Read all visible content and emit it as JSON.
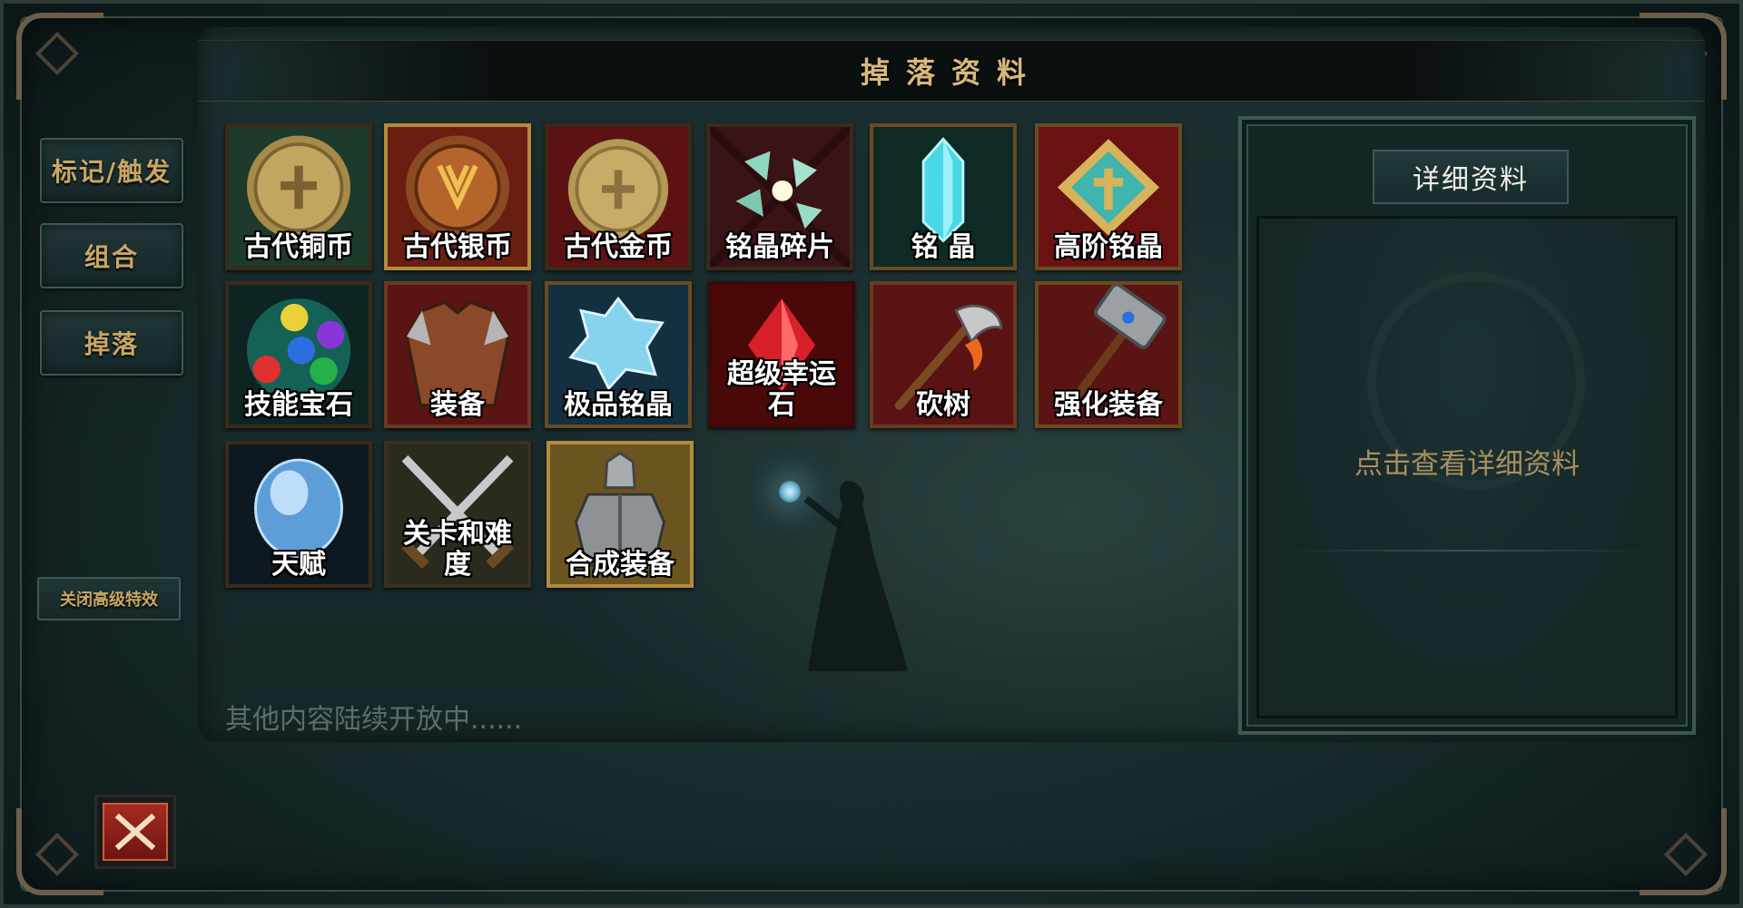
{
  "title": "掉落资料",
  "nav": {
    "tab_mark": "标记/触发",
    "tab_combo": "组合",
    "tab_drop": "掉落",
    "fx_toggle": "关闭高级特效"
  },
  "items": [
    {
      "label": "古代铜币",
      "icon": "bronze-coin"
    },
    {
      "label": "古代银币",
      "icon": "silver-coin"
    },
    {
      "label": "古代金币",
      "icon": "gold-coin"
    },
    {
      "label": "铭晶碎片",
      "icon": "crystal-shards"
    },
    {
      "label": "铭  晶",
      "icon": "crystal"
    },
    {
      "label": "高阶铭晶",
      "icon": "high-crystal"
    },
    {
      "label": "技能宝石",
      "icon": "skill-gems"
    },
    {
      "label": "装备",
      "icon": "armor"
    },
    {
      "label": "极品铭晶",
      "icon": "premium-crystal"
    },
    {
      "label": "超级幸运石",
      "icon": "lucky-stone"
    },
    {
      "label": "砍树",
      "icon": "axe"
    },
    {
      "label": "强化装备",
      "icon": "hammer"
    },
    {
      "label": "天赋",
      "icon": "talent-orb"
    },
    {
      "label": "关卡和难度",
      "icon": "crossed-swords"
    },
    {
      "label": "合成装备",
      "icon": "knight"
    }
  ],
  "footer": "其他内容陆续开放中......",
  "detail": {
    "tab": "详细资料",
    "hint": "点击查看详细资料"
  },
  "colors": {
    "accent_gold": "#c9a663",
    "panel_bg": "#152627"
  }
}
